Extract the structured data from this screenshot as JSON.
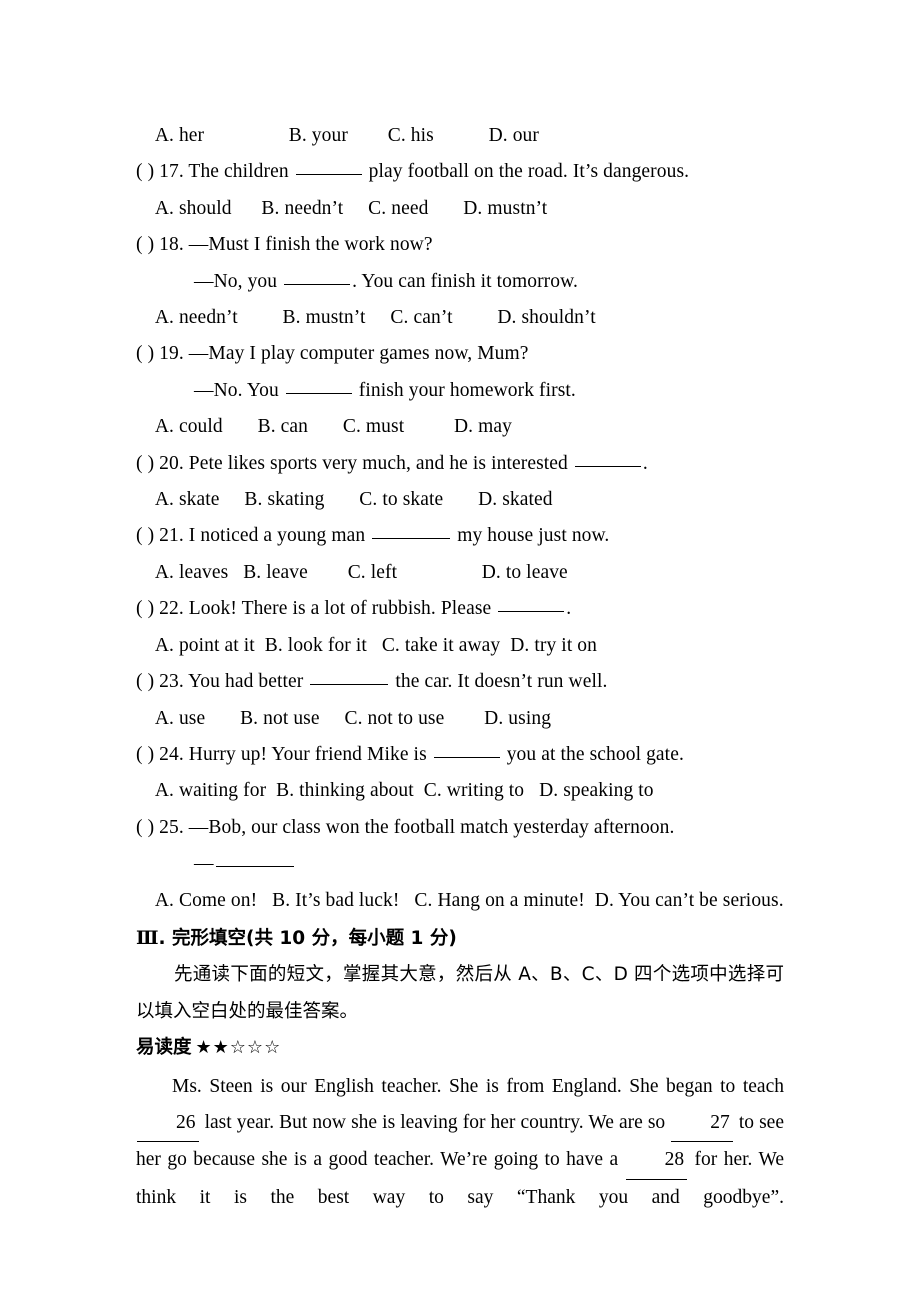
{
  "document": {
    "type": "english-exam-paper",
    "language": "zh-CN + en"
  },
  "questions": [
    {
      "id": "q16-options",
      "kind": "options-only",
      "text": "    A. her                 B. your        C. his           D. our"
    },
    {
      "id": "q17",
      "kind": "question",
      "prefix": "( ) 17. ",
      "text_before": "( ) 17. The children ",
      "text_after": " play football on the road. It’s dangerous.",
      "options": "    A. should      B. needn’t     C. need       D. mustn’t"
    },
    {
      "id": "q18",
      "kind": "question-dialogue",
      "stem": "( ) 18. —Must I finish the work now?",
      "reply_before": "—No, you ",
      "reply_after": ". You can finish it tomorrow.",
      "options": "    A. needn’t         B. mustn’t     C. can’t         D. shouldn’t"
    },
    {
      "id": "q19",
      "kind": "question-dialogue",
      "stem": "( ) 19. —May I play computer games now, Mum?",
      "reply_before": "—No. You ",
      "reply_after": " finish your homework first.",
      "options": "    A. could       B. can       C. must          D. may"
    },
    {
      "id": "q20",
      "kind": "question",
      "text_before": "( ) 20. Pete likes sports very much, and he is interested ",
      "text_after": ".",
      "options": "    A. skate     B. skating       C. to skate       D. skated"
    },
    {
      "id": "q21",
      "kind": "question",
      "text_before": "( ) 21. I noticed a young man ",
      "text_after": " my house just now.",
      "options": "    A. leaves   B. leave        C. left                 D. to leave"
    },
    {
      "id": "q22",
      "kind": "question",
      "text_before": "( ) 22. Look! There is a lot of rubbish. Please ",
      "text_after": ".",
      "options": "    A. point at it  B. look for it   C. take it away  D. try it on"
    },
    {
      "id": "q23",
      "kind": "question",
      "text_before": "( ) 23. You had better ",
      "text_after": " the car. It doesn’t run well.",
      "options": "    A. use       B. not use     C. not to use        D. using"
    },
    {
      "id": "q24",
      "kind": "question",
      "text_before": "( ) 24. Hurry up! Your friend Mike is ",
      "text_after": " you at the school gate.",
      "options": "    A. waiting for  B. thinking about  C. writing to   D. speaking to"
    },
    {
      "id": "q25",
      "kind": "question-dialogue",
      "stem": "( ) 25. —Bob, our class won the football match yesterday afternoon.",
      "reply_before": "—",
      "reply_after": "",
      "options": "    A. Come on!   B. It’s bad luck!   C. Hang on a minute!  D. You can’t be serious."
    }
  ],
  "section": {
    "roman": "Ⅲ",
    "heading": ". 完形填空(共 10 分，每小题 1 分)",
    "instruction": "先通读下面的短文，掌握其大意，然后从 A、B、C、D 四个选项中选择可以填入空白处的最佳答案。",
    "rating_label": "易读度",
    "rating_stars": "★★☆☆☆",
    "rating_filled": 2,
    "rating_total": 5
  },
  "passage": {
    "part1": "Ms. Steen is our English teacher. She is from England. She began to teach ",
    "blank1": "26",
    "part2": " last year. But now she is leaving for her country. We are so ",
    "blank2": "27",
    "part3": " to see her go because she is a good teacher. We’re going to have a ",
    "blank3": "28",
    "part4": " for her. We think it is the best way to say “Thank you and goodbye”."
  }
}
